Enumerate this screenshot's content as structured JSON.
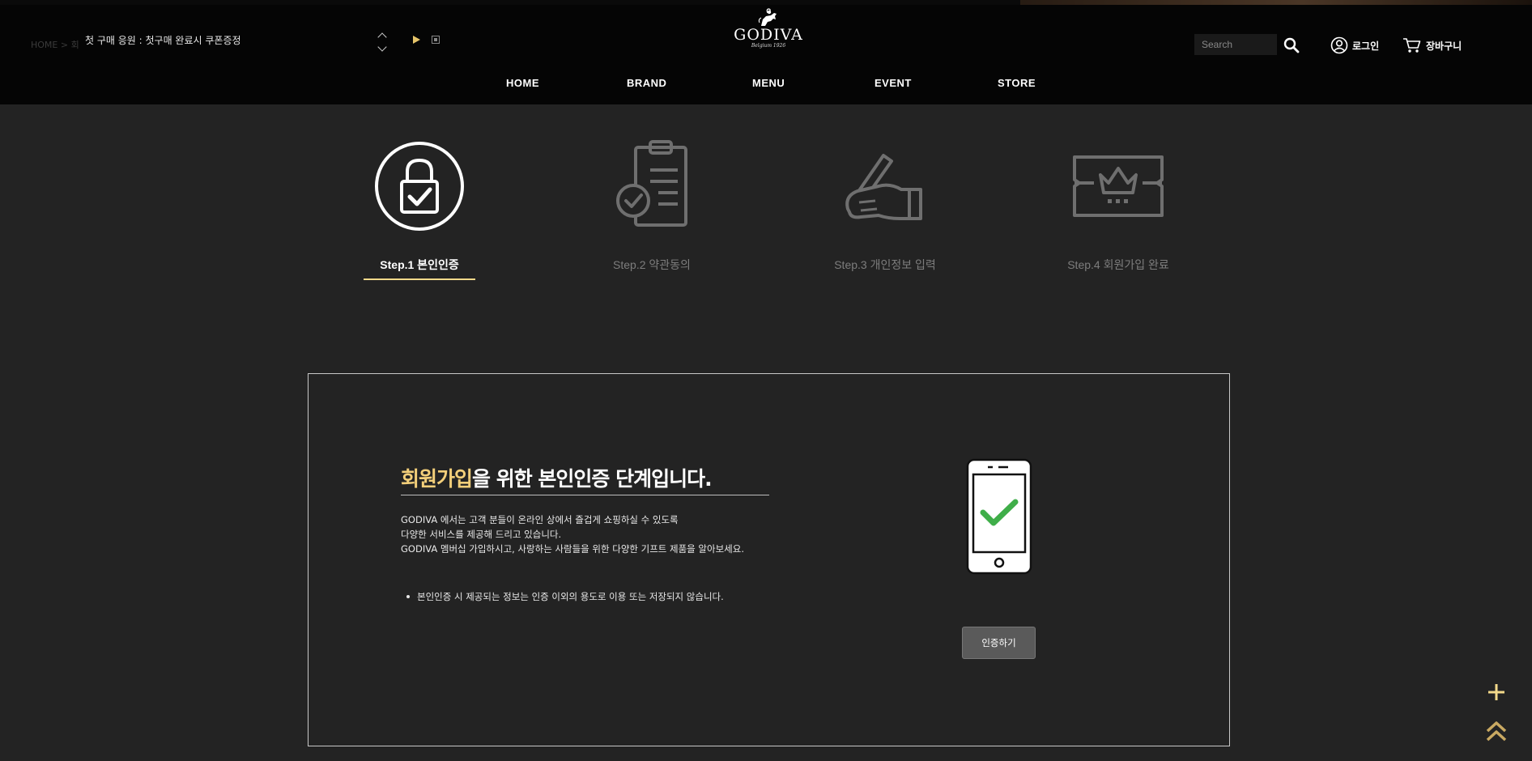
{
  "header": {
    "notice_text": "첫 구매 응원 : 첫구매 완료시 쿠폰증정",
    "notice_ghost": "HOME > 회",
    "logo": {
      "name": "GODIVA",
      "sub": "Belgium 1926"
    },
    "search": {
      "placeholder": "Search",
      "value": ""
    },
    "login_label": "로그인",
    "cart_label": "장바구니",
    "accent_color": "#f3cf7a"
  },
  "nav": {
    "items": [
      {
        "label": "HOME"
      },
      {
        "label": "BRAND"
      },
      {
        "label": "MENU"
      },
      {
        "label": "EVENT"
      },
      {
        "label": "STORE"
      }
    ]
  },
  "steps": [
    {
      "label": "Step.1 본인인증",
      "icon": "lock-check-icon",
      "active": true
    },
    {
      "label": "Step.2 약관동의",
      "icon": "clipboard-check-icon",
      "active": false
    },
    {
      "label": "Step.3 개인정보 입력",
      "icon": "hand-pen-icon",
      "active": false
    },
    {
      "label": "Step.4 회원가입 완료",
      "icon": "crown-ticket-icon",
      "active": false
    }
  ],
  "panel": {
    "title_highlight": "회원가입",
    "title_rest": "을 위한 본인인증 단계입니다.",
    "desc": [
      "GODIVA 에서는 고객 분들이 온라인 상에서 즐겁게 쇼핑하실 수 있도록",
      "다양한 서비스를 제공해 드리고 있습니다.",
      "GODIVA 멤버십 가입하시고, 사랑하는 사람들을 위한 다양한 기프트 제품을 알아보세요."
    ],
    "note": "본인인증 시 제공되는 정보는 인증 이외의 용도로 이용 또는 저장되지 않습니다.",
    "verify_button": "인증하기",
    "check_color": "#3fae49"
  },
  "floating": {
    "plus_icon": "plus-icon",
    "top_icon": "double-chevron-up-icon"
  }
}
